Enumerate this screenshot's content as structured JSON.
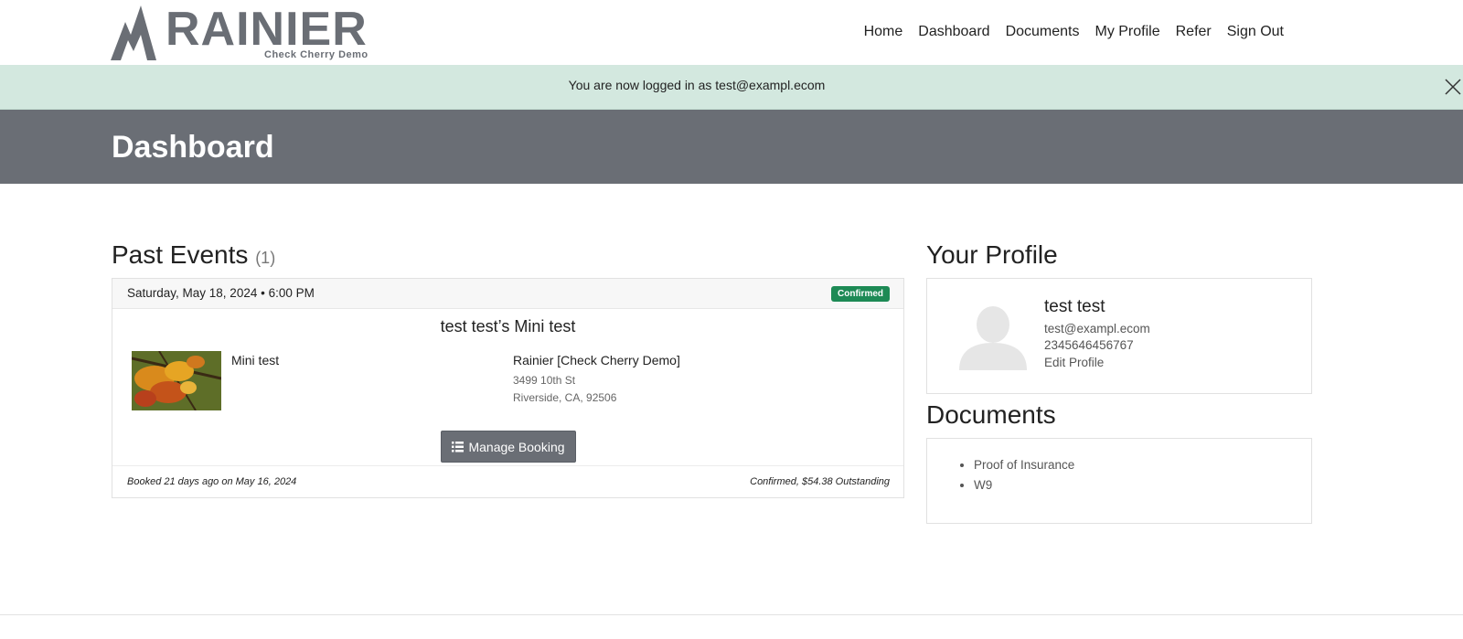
{
  "brand": {
    "logo_text": "RAINIER",
    "logo_sub": "Check Cherry Demo"
  },
  "nav": {
    "items": [
      "Home",
      "Dashboard",
      "Documents",
      "My Profile",
      "Refer",
      "Sign Out"
    ]
  },
  "alert": {
    "message": "You are now logged in as test@exampl.ecom"
  },
  "page": {
    "title": "Dashboard"
  },
  "past_events": {
    "title": "Past Events",
    "count": "(1)",
    "event": {
      "date": "Saturday, May 18, 2024 • 6:00 PM",
      "status": "Confirmed",
      "title": "test test’s Mini test",
      "package": "Mini test",
      "venue_name": "Rainier [Check Cherry Demo]",
      "venue_address1": "3499 10th St",
      "venue_address2": "Riverside, CA, 92506",
      "manage_label": "Manage Booking",
      "booked_text": "Booked 21 days ago on May 16, 2024",
      "balance_text": "Confirmed, $54.38 Outstanding"
    }
  },
  "profile": {
    "title": "Your Profile",
    "name": "test test",
    "email": "test@exampl.ecom",
    "phone": "2345646456767",
    "edit_label": "Edit Profile"
  },
  "documents": {
    "title": "Documents",
    "items": [
      "Proof of Insurance",
      "W9"
    ]
  },
  "colors": {
    "banner": "#6a6e75",
    "alert_bg": "#d3e8df",
    "badge": "#1d8a55"
  },
  "icons": {
    "alert_close": "close-icon",
    "manage": "list-icon",
    "avatar": "user-silhouette-icon"
  }
}
